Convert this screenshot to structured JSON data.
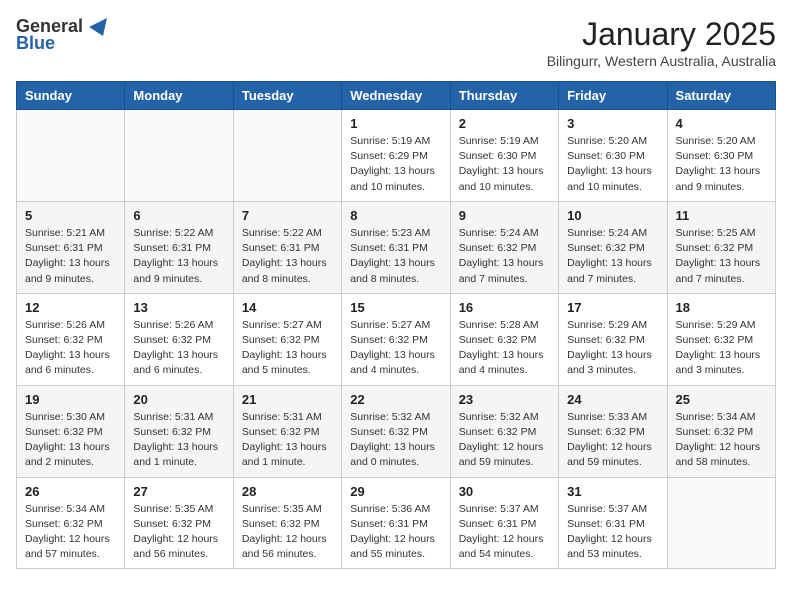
{
  "header": {
    "logo_general": "General",
    "logo_blue": "Blue",
    "month": "January 2025",
    "location": "Bilingurr, Western Australia, Australia"
  },
  "days_of_week": [
    "Sunday",
    "Monday",
    "Tuesday",
    "Wednesday",
    "Thursday",
    "Friday",
    "Saturday"
  ],
  "weeks": [
    {
      "days": [
        {
          "number": "",
          "info": ""
        },
        {
          "number": "",
          "info": ""
        },
        {
          "number": "",
          "info": ""
        },
        {
          "number": "1",
          "info": "Sunrise: 5:19 AM\nSunset: 6:29 PM\nDaylight: 13 hours\nand 10 minutes."
        },
        {
          "number": "2",
          "info": "Sunrise: 5:19 AM\nSunset: 6:30 PM\nDaylight: 13 hours\nand 10 minutes."
        },
        {
          "number": "3",
          "info": "Sunrise: 5:20 AM\nSunset: 6:30 PM\nDaylight: 13 hours\nand 10 minutes."
        },
        {
          "number": "4",
          "info": "Sunrise: 5:20 AM\nSunset: 6:30 PM\nDaylight: 13 hours\nand 9 minutes."
        }
      ]
    },
    {
      "days": [
        {
          "number": "5",
          "info": "Sunrise: 5:21 AM\nSunset: 6:31 PM\nDaylight: 13 hours\nand 9 minutes."
        },
        {
          "number": "6",
          "info": "Sunrise: 5:22 AM\nSunset: 6:31 PM\nDaylight: 13 hours\nand 9 minutes."
        },
        {
          "number": "7",
          "info": "Sunrise: 5:22 AM\nSunset: 6:31 PM\nDaylight: 13 hours\nand 8 minutes."
        },
        {
          "number": "8",
          "info": "Sunrise: 5:23 AM\nSunset: 6:31 PM\nDaylight: 13 hours\nand 8 minutes."
        },
        {
          "number": "9",
          "info": "Sunrise: 5:24 AM\nSunset: 6:32 PM\nDaylight: 13 hours\nand 7 minutes."
        },
        {
          "number": "10",
          "info": "Sunrise: 5:24 AM\nSunset: 6:32 PM\nDaylight: 13 hours\nand 7 minutes."
        },
        {
          "number": "11",
          "info": "Sunrise: 5:25 AM\nSunset: 6:32 PM\nDaylight: 13 hours\nand 7 minutes."
        }
      ]
    },
    {
      "days": [
        {
          "number": "12",
          "info": "Sunrise: 5:26 AM\nSunset: 6:32 PM\nDaylight: 13 hours\nand 6 minutes."
        },
        {
          "number": "13",
          "info": "Sunrise: 5:26 AM\nSunset: 6:32 PM\nDaylight: 13 hours\nand 6 minutes."
        },
        {
          "number": "14",
          "info": "Sunrise: 5:27 AM\nSunset: 6:32 PM\nDaylight: 13 hours\nand 5 minutes."
        },
        {
          "number": "15",
          "info": "Sunrise: 5:27 AM\nSunset: 6:32 PM\nDaylight: 13 hours\nand 4 minutes."
        },
        {
          "number": "16",
          "info": "Sunrise: 5:28 AM\nSunset: 6:32 PM\nDaylight: 13 hours\nand 4 minutes."
        },
        {
          "number": "17",
          "info": "Sunrise: 5:29 AM\nSunset: 6:32 PM\nDaylight: 13 hours\nand 3 minutes."
        },
        {
          "number": "18",
          "info": "Sunrise: 5:29 AM\nSunset: 6:32 PM\nDaylight: 13 hours\nand 3 minutes."
        }
      ]
    },
    {
      "days": [
        {
          "number": "19",
          "info": "Sunrise: 5:30 AM\nSunset: 6:32 PM\nDaylight: 13 hours\nand 2 minutes."
        },
        {
          "number": "20",
          "info": "Sunrise: 5:31 AM\nSunset: 6:32 PM\nDaylight: 13 hours\nand 1 minute."
        },
        {
          "number": "21",
          "info": "Sunrise: 5:31 AM\nSunset: 6:32 PM\nDaylight: 13 hours\nand 1 minute."
        },
        {
          "number": "22",
          "info": "Sunrise: 5:32 AM\nSunset: 6:32 PM\nDaylight: 13 hours\nand 0 minutes."
        },
        {
          "number": "23",
          "info": "Sunrise: 5:32 AM\nSunset: 6:32 PM\nDaylight: 12 hours\nand 59 minutes."
        },
        {
          "number": "24",
          "info": "Sunrise: 5:33 AM\nSunset: 6:32 PM\nDaylight: 12 hours\nand 59 minutes."
        },
        {
          "number": "25",
          "info": "Sunrise: 5:34 AM\nSunset: 6:32 PM\nDaylight: 12 hours\nand 58 minutes."
        }
      ]
    },
    {
      "days": [
        {
          "number": "26",
          "info": "Sunrise: 5:34 AM\nSunset: 6:32 PM\nDaylight: 12 hours\nand 57 minutes."
        },
        {
          "number": "27",
          "info": "Sunrise: 5:35 AM\nSunset: 6:32 PM\nDaylight: 12 hours\nand 56 minutes."
        },
        {
          "number": "28",
          "info": "Sunrise: 5:35 AM\nSunset: 6:32 PM\nDaylight: 12 hours\nand 56 minutes."
        },
        {
          "number": "29",
          "info": "Sunrise: 5:36 AM\nSunset: 6:31 PM\nDaylight: 12 hours\nand 55 minutes."
        },
        {
          "number": "30",
          "info": "Sunrise: 5:37 AM\nSunset: 6:31 PM\nDaylight: 12 hours\nand 54 minutes."
        },
        {
          "number": "31",
          "info": "Sunrise: 5:37 AM\nSunset: 6:31 PM\nDaylight: 12 hours\nand 53 minutes."
        },
        {
          "number": "",
          "info": ""
        }
      ]
    }
  ]
}
